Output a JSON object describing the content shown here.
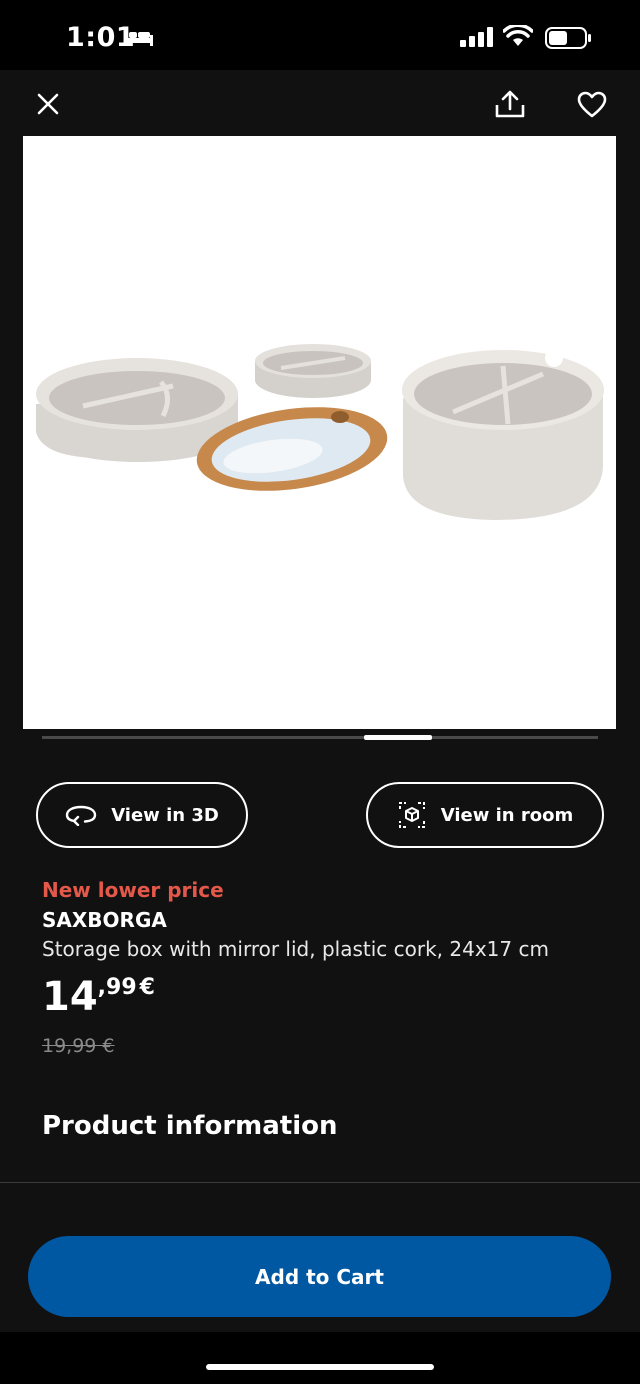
{
  "status_bar": {
    "time": "1:01"
  },
  "top_bar": {
    "close_icon": "close-icon",
    "share_icon": "share-icon",
    "favorite_icon": "heart-icon"
  },
  "carousel": {
    "position_fraction": 0.66
  },
  "buttons": {
    "view_3d": "View in 3D",
    "view_room": "View in room"
  },
  "product": {
    "promo_label": "New lower price",
    "name": "SAXBORGA",
    "description": "Storage box with mirror lid, plastic cork, 24x17 cm",
    "price_integer": "14",
    "price_decimal": ",99",
    "currency": "€",
    "old_price": "19,99 €"
  },
  "section": {
    "product_info_title": "Product information"
  },
  "cta": {
    "add_to_cart": "Add to Cart"
  },
  "colors": {
    "accent_blue": "#0058a3",
    "promo_red": "#e4584a",
    "background": "#111111"
  }
}
